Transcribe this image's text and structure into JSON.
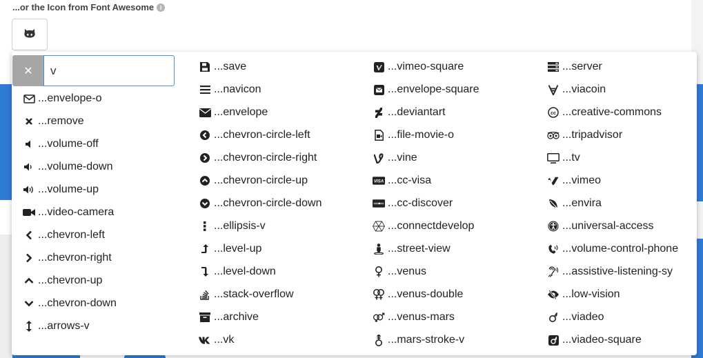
{
  "section": {
    "label": "...or the Icon from Font Awesome",
    "info_icon": "info-circle-icon"
  },
  "selected_icon": "github-alt-icon",
  "search": {
    "value": "v",
    "clear_icon": "times-icon"
  },
  "columns": [
    [
      {
        "icon": "envelope-o-icon",
        "label": "...envelope-o"
      },
      {
        "icon": "remove-icon",
        "label": "...remove"
      },
      {
        "icon": "volume-off-icon",
        "label": "...volume-off"
      },
      {
        "icon": "volume-down-icon",
        "label": "...volume-down"
      },
      {
        "icon": "volume-up-icon",
        "label": "...volume-up"
      },
      {
        "icon": "video-camera-icon",
        "label": "...video-camera"
      },
      {
        "icon": "chevron-left-icon",
        "label": "...chevron-left"
      },
      {
        "icon": "chevron-right-icon",
        "label": "...chevron-right"
      },
      {
        "icon": "chevron-up-icon",
        "label": "...chevron-up"
      },
      {
        "icon": "chevron-down-icon",
        "label": "...chevron-down"
      },
      {
        "icon": "arrows-v-icon",
        "label": "...arrows-v"
      }
    ],
    [
      {
        "icon": "save-icon",
        "label": "...save"
      },
      {
        "icon": "navicon-icon",
        "label": "...navicon"
      },
      {
        "icon": "envelope-icon",
        "label": "...envelope"
      },
      {
        "icon": "chevron-circle-left-icon",
        "label": "...chevron-circle-left"
      },
      {
        "icon": "chevron-circle-right-icon",
        "label": "...chevron-circle-right"
      },
      {
        "icon": "chevron-circle-up-icon",
        "label": "...chevron-circle-up"
      },
      {
        "icon": "chevron-circle-down-icon",
        "label": "...chevron-circle-down"
      },
      {
        "icon": "ellipsis-v-icon",
        "label": "...ellipsis-v"
      },
      {
        "icon": "level-up-icon",
        "label": "...level-up"
      },
      {
        "icon": "level-down-icon",
        "label": "...level-down"
      },
      {
        "icon": "stack-overflow-icon",
        "label": "...stack-overflow"
      },
      {
        "icon": "archive-icon",
        "label": "...archive"
      },
      {
        "icon": "vk-icon",
        "label": "...vk"
      }
    ],
    [
      {
        "icon": "vimeo-square-icon",
        "label": "...vimeo-square"
      },
      {
        "icon": "envelope-square-icon",
        "label": "...envelope-square"
      },
      {
        "icon": "deviantart-icon",
        "label": "...deviantart"
      },
      {
        "icon": "file-movie-o-icon",
        "label": "...file-movie-o"
      },
      {
        "icon": "vine-icon",
        "label": "...vine"
      },
      {
        "icon": "cc-visa-icon",
        "label": "...cc-visa"
      },
      {
        "icon": "cc-discover-icon",
        "label": "...cc-discover"
      },
      {
        "icon": "connectdevelop-icon",
        "label": "...connectdevelop"
      },
      {
        "icon": "street-view-icon",
        "label": "...street-view"
      },
      {
        "icon": "venus-icon",
        "label": "...venus"
      },
      {
        "icon": "venus-double-icon",
        "label": "...venus-double"
      },
      {
        "icon": "venus-mars-icon",
        "label": "...venus-mars"
      },
      {
        "icon": "mars-stroke-v-icon",
        "label": "...mars-stroke-v"
      }
    ],
    [
      {
        "icon": "server-icon",
        "label": "...server"
      },
      {
        "icon": "viacoin-icon",
        "label": "...viacoin"
      },
      {
        "icon": "creative-commons-icon",
        "label": "...creative-commons"
      },
      {
        "icon": "tripadvisor-icon",
        "label": "...tripadvisor"
      },
      {
        "icon": "tv-icon",
        "label": "...tv"
      },
      {
        "icon": "vimeo-icon",
        "label": "...vimeo"
      },
      {
        "icon": "envira-icon",
        "label": "...envira"
      },
      {
        "icon": "universal-access-icon",
        "label": "...universal-access"
      },
      {
        "icon": "volume-control-phone-icon",
        "label": "...volume-control-phone"
      },
      {
        "icon": "assistive-listening-sy-icon",
        "label": "...assistive-listening-sy"
      },
      {
        "icon": "low-vision-icon",
        "label": "...low-vision"
      },
      {
        "icon": "viadeo-icon",
        "label": "...viadeo"
      },
      {
        "icon": "viadeo-square-icon",
        "label": "...viadeo-square"
      }
    ]
  ]
}
